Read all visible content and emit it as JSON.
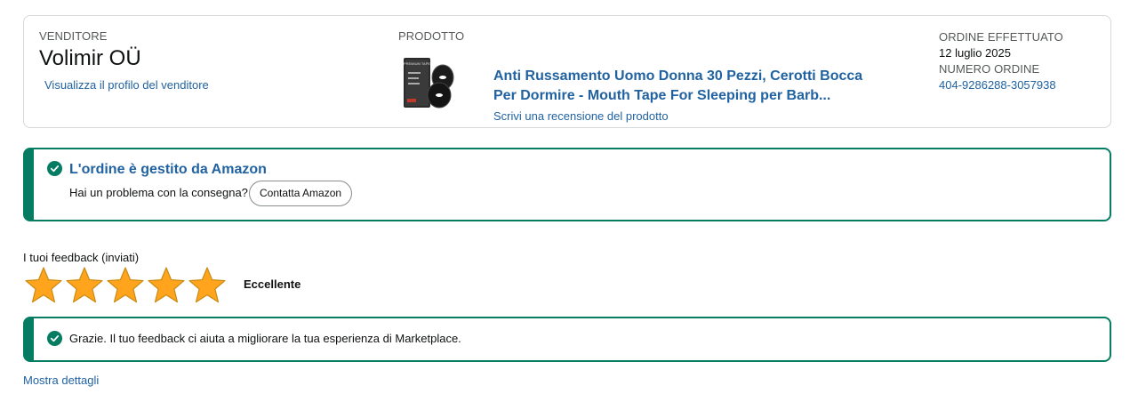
{
  "seller": {
    "label": "VENDITORE",
    "name": "Volimir OÜ",
    "profile_link": "Visualizza il profilo del venditore"
  },
  "product": {
    "label": "PRODOTTO",
    "title": "Anti Russamento Uomo Donna 30 Pezzi, Cerotti Bocca Per Dormire - Mouth Tape For Sleeping per Barb...",
    "review_link": "Scrivi una recensione del prodotto",
    "image_text": "PREMIUM TAPE"
  },
  "order": {
    "date_label": "ORDINE EFFETTUATO",
    "date_value": "12 luglio 2025",
    "number_label": "NUMERO ORDINE",
    "number_value": "404-9286288-3057938"
  },
  "amazon_alert": {
    "title": "L'ordine è gestito da Amazon",
    "question": "Hai un problema con la consegna?",
    "button": "Contatta Amazon"
  },
  "feedback": {
    "label": "I tuoi feedback (inviati)",
    "rating": 5,
    "max_rating": 5,
    "rating_text": "Eccellente",
    "thanks": "Grazie. Il tuo feedback ci aiuta a migliorare la tua esperienza di Marketplace.",
    "details_link": "Mostra dettagli"
  },
  "colors": {
    "link": "#2162a1",
    "success": "#067D62",
    "star": "#FFA41C",
    "border": "#D5D9D9"
  },
  "icons": [
    "check-circle-icon",
    "star-icon"
  ]
}
